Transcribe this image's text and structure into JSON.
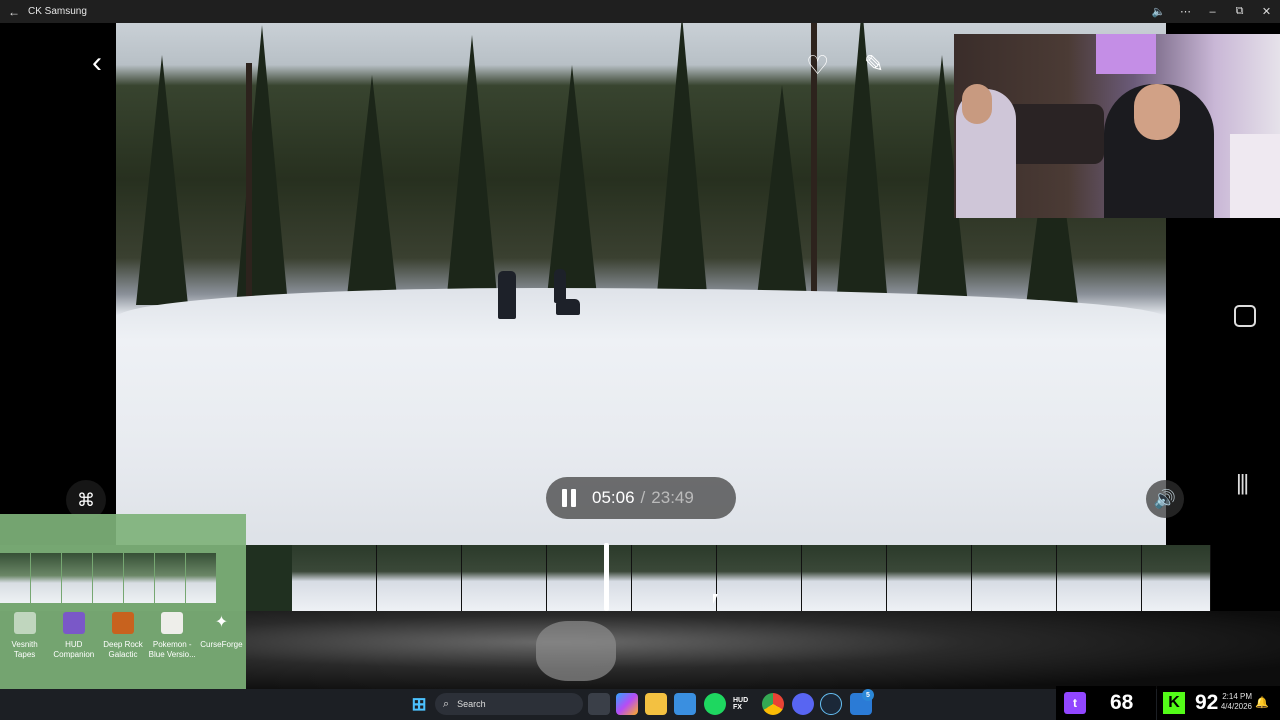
{
  "window": {
    "title": "CK Samsung",
    "back_glyph": "←",
    "controls": {
      "volume": "🔈",
      "more": "⋯",
      "minimize": "–",
      "maximize": "⧉",
      "close": "✕"
    }
  },
  "viewer": {
    "back_glyph": "‹",
    "favorite_glyph": "♡",
    "edit_glyph": "✎",
    "capture_glyph": "⌘",
    "volume_glyph": "🔊",
    "recents_glyph": "|||"
  },
  "player": {
    "current_time": "05:06",
    "separator": "/",
    "total_time": "23:49",
    "state": "playing",
    "progress_fraction": 0.214
  },
  "desktop_icons": [
    {
      "label": "Vesnith Tapes",
      "icon": "app-icon"
    },
    {
      "label": "HUD Companion",
      "icon": "hud-icon"
    },
    {
      "label": "Deep Rock Galactic",
      "icon": "deep-rock-icon"
    },
    {
      "label": "Pokemon - Blue Versio...",
      "icon": "pokemon-icon"
    },
    {
      "label": "CurseForge",
      "icon": "curseforge-icon"
    }
  ],
  "taskbar": {
    "search_placeholder": "Search",
    "apps": [
      "start-icon",
      "task-view-icon",
      "copilot-icon",
      "file-explorer-icon",
      "notepad-icon",
      "spotify-icon",
      "hud-fx-icon",
      "chrome-icon",
      "discord-icon",
      "steam-icon",
      "store-icon"
    ],
    "hud_label": "HUD FX",
    "notification_badge": "5"
  },
  "tray": {
    "twitch_viewers": "68",
    "kick_viewers": "92",
    "time": "2:14 PM",
    "date": "4/4/2026"
  },
  "colors": {
    "twitch": "#9146ff",
    "kick": "#53fc18",
    "desktop_overlay": "#7eb27a"
  }
}
